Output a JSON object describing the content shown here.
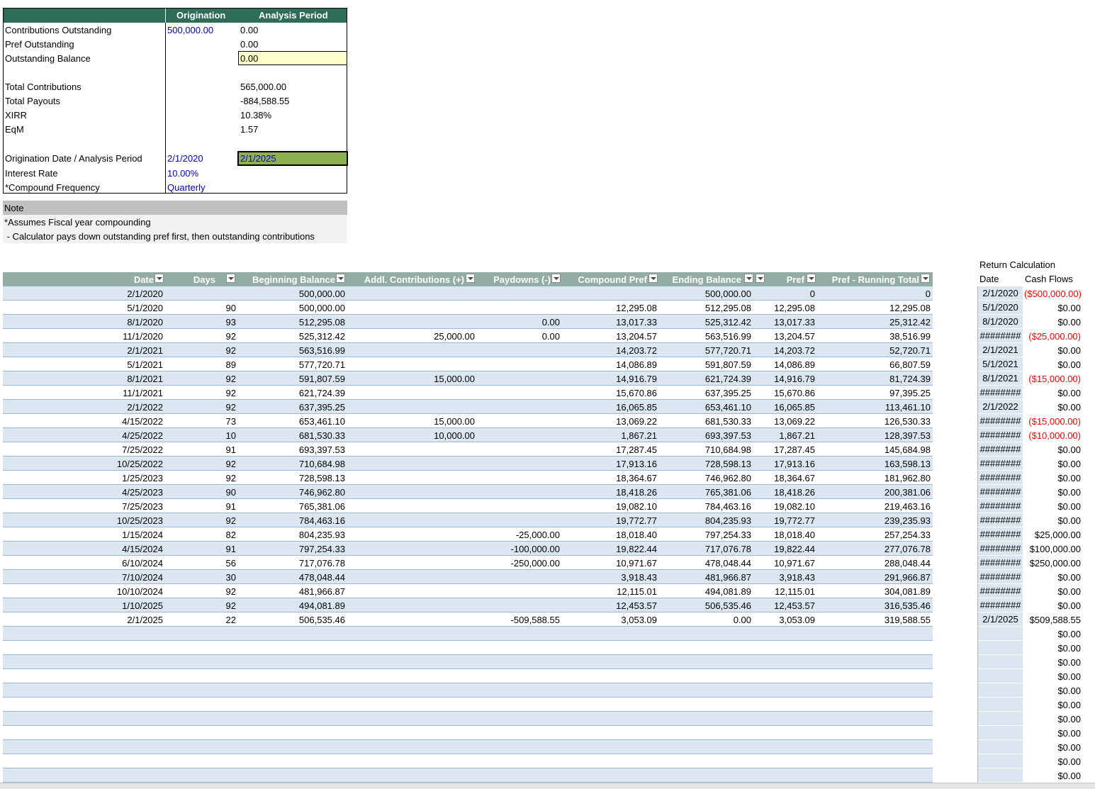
{
  "summary": {
    "col_origination": "Origination",
    "col_analysis": "Analysis Period",
    "rows": [
      {
        "label": "Contributions Outstanding",
        "origination": "500,000.00",
        "analysis": "0.00"
      },
      {
        "label": "Pref Outstanding",
        "origination": "",
        "analysis": "0.00"
      },
      {
        "label": "Outstanding Balance",
        "origination": "",
        "analysis": "0.00"
      },
      {
        "label": "Total Contributions",
        "origination": "",
        "analysis": "565,000.00"
      },
      {
        "label": "Total Payouts",
        "origination": "",
        "analysis": "-884,588.55"
      },
      {
        "label": "XIRR",
        "origination": "",
        "analysis": "10.38%"
      },
      {
        "label": "EqM",
        "origination": "",
        "analysis": "1.57"
      },
      {
        "label": "Origination Date / Analysis Period",
        "origination": "2/1/2020",
        "analysis": "2/1/2025"
      },
      {
        "label": "Interest Rate",
        "origination": "10.00%",
        "analysis": ""
      },
      {
        "label": "*Compound Frequency",
        "origination": "Quarterly",
        "analysis": ""
      }
    ]
  },
  "note": {
    "title": "Note",
    "lines": [
      "*Assumes Fiscal year compounding",
      " - Calculator pays down outstanding pref first, then outstanding contributions"
    ]
  },
  "table": {
    "columns": [
      "Date",
      "Days",
      "Beginning Balance",
      "Addl. Contributions (+)",
      "Paydowns (-)",
      "Compound Pref",
      "Ending Balance",
      "Pref",
      "Pref - Running Total"
    ],
    "rows": [
      [
        "2/1/2020",
        "",
        "500,000.00",
        "",
        "",
        "",
        "500,000.00",
        "0",
        "0"
      ],
      [
        "5/1/2020",
        "90",
        "500,000.00",
        "",
        "",
        "12,295.08",
        "512,295.08",
        "12,295.08",
        "12,295.08"
      ],
      [
        "8/1/2020",
        "93",
        "512,295.08",
        "",
        "0.00",
        "13,017.33",
        "525,312.42",
        "13,017.33",
        "25,312.42"
      ],
      [
        "11/1/2020",
        "92",
        "525,312.42",
        "25,000.00",
        "0.00",
        "13,204.57",
        "563,516.99",
        "13,204.57",
        "38,516.99"
      ],
      [
        "2/1/2021",
        "92",
        "563,516.99",
        "",
        "",
        "14,203.72",
        "577,720.71",
        "14,203.72",
        "52,720.71"
      ],
      [
        "5/1/2021",
        "89",
        "577,720.71",
        "",
        "",
        "14,086.89",
        "591,807.59",
        "14,086.89",
        "66,807.59"
      ],
      [
        "8/1/2021",
        "92",
        "591,807.59",
        "15,000.00",
        "",
        "14,916.79",
        "621,724.39",
        "14,916.79",
        "81,724.39"
      ],
      [
        "11/1/2021",
        "92",
        "621,724.39",
        "",
        "",
        "15,670.86",
        "637,395.25",
        "15,670.86",
        "97,395.25"
      ],
      [
        "2/1/2022",
        "92",
        "637,395.25",
        "",
        "",
        "16,065.85",
        "653,461.10",
        "16,065.85",
        "113,461.10"
      ],
      [
        "4/15/2022",
        "73",
        "653,461.10",
        "15,000.00",
        "",
        "13,069.22",
        "681,530.33",
        "13,069.22",
        "126,530.33"
      ],
      [
        "4/25/2022",
        "10",
        "681,530.33",
        "10,000.00",
        "",
        "1,867.21",
        "693,397.53",
        "1,867.21",
        "128,397.53"
      ],
      [
        "7/25/2022",
        "91",
        "693,397.53",
        "",
        "",
        "17,287.45",
        "710,684.98",
        "17,287.45",
        "145,684.98"
      ],
      [
        "10/25/2022",
        "92",
        "710,684.98",
        "",
        "",
        "17,913.16",
        "728,598.13",
        "17,913.16",
        "163,598.13"
      ],
      [
        "1/25/2023",
        "92",
        "728,598.13",
        "",
        "",
        "18,364.67",
        "746,962.80",
        "18,364.67",
        "181,962.80"
      ],
      [
        "4/25/2023",
        "90",
        "746,962.80",
        "",
        "",
        "18,418.26",
        "765,381.06",
        "18,418.26",
        "200,381.06"
      ],
      [
        "7/25/2023",
        "91",
        "765,381.06",
        "",
        "",
        "19,082.10",
        "784,463.16",
        "19,082.10",
        "219,463.16"
      ],
      [
        "10/25/2023",
        "92",
        "784,463.16",
        "",
        "",
        "19,772.77",
        "804,235.93",
        "19,772.77",
        "239,235.93"
      ],
      [
        "1/15/2024",
        "82",
        "804,235.93",
        "",
        "-25,000.00",
        "18,018.40",
        "797,254.33",
        "18,018.40",
        "257,254.33"
      ],
      [
        "4/15/2024",
        "91",
        "797,254.33",
        "",
        "-100,000.00",
        "19,822.44",
        "717,076.78",
        "19,822.44",
        "277,076.78"
      ],
      [
        "6/10/2024",
        "56",
        "717,076.78",
        "",
        "-250,000.00",
        "10,971.67",
        "478,048.44",
        "10,971.67",
        "288,048.44"
      ],
      [
        "7/10/2024",
        "30",
        "478,048.44",
        "",
        "",
        "3,918.43",
        "481,966.87",
        "3,918.43",
        "291,966.87"
      ],
      [
        "10/10/2024",
        "92",
        "481,966.87",
        "",
        "",
        "12,115.01",
        "494,081.89",
        "12,115.01",
        "304,081.89"
      ],
      [
        "1/10/2025",
        "92",
        "494,081.89",
        "",
        "",
        "12,453.57",
        "506,535.46",
        "12,453.57",
        "316,535.46"
      ],
      [
        "2/1/2025",
        "22",
        "506,535.46",
        "",
        "-509,588.55",
        "3,053.09",
        "0.00",
        "3,053.09",
        "319,588.55"
      ]
    ]
  },
  "return_calc": {
    "title": "Return Calculation",
    "date_header": "Date",
    "cf_header": "Cash Flows",
    "rows": [
      {
        "date": "2/1/2020",
        "cf": "($500,000.00)",
        "neg": true
      },
      {
        "date": "5/1/2020",
        "cf": "$0.00",
        "neg": false
      },
      {
        "date": "8/1/2020",
        "cf": "$0.00",
        "neg": false
      },
      {
        "date": "########",
        "cf": "($25,000.00)",
        "neg": true
      },
      {
        "date": "2/1/2021",
        "cf": "$0.00",
        "neg": false
      },
      {
        "date": "5/1/2021",
        "cf": "$0.00",
        "neg": false
      },
      {
        "date": "8/1/2021",
        "cf": "($15,000.00)",
        "neg": true
      },
      {
        "date": "########",
        "cf": "$0.00",
        "neg": false
      },
      {
        "date": "2/1/2022",
        "cf": "$0.00",
        "neg": false
      },
      {
        "date": "########",
        "cf": "($15,000.00)",
        "neg": true
      },
      {
        "date": "########",
        "cf": "($10,000.00)",
        "neg": true
      },
      {
        "date": "########",
        "cf": "$0.00",
        "neg": false
      },
      {
        "date": "########",
        "cf": "$0.00",
        "neg": false
      },
      {
        "date": "########",
        "cf": "$0.00",
        "neg": false
      },
      {
        "date": "########",
        "cf": "$0.00",
        "neg": false
      },
      {
        "date": "########",
        "cf": "$0.00",
        "neg": false
      },
      {
        "date": "########",
        "cf": "$0.00",
        "neg": false
      },
      {
        "date": "########",
        "cf": "$25,000.00",
        "neg": false
      },
      {
        "date": "########",
        "cf": "$100,000.00",
        "neg": false
      },
      {
        "date": "########",
        "cf": "$250,000.00",
        "neg": false
      },
      {
        "date": "########",
        "cf": "$0.00",
        "neg": false
      },
      {
        "date": "########",
        "cf": "$0.00",
        "neg": false
      },
      {
        "date": "########",
        "cf": "$0.00",
        "neg": false
      },
      {
        "date": "2/1/2025",
        "cf": "$509,588.55",
        "neg": false
      },
      {
        "date": "",
        "cf": "$0.00",
        "neg": false
      },
      {
        "date": "",
        "cf": "$0.00",
        "neg": false
      },
      {
        "date": "",
        "cf": "$0.00",
        "neg": false
      },
      {
        "date": "",
        "cf": "$0.00",
        "neg": false
      },
      {
        "date": "",
        "cf": "$0.00",
        "neg": false
      },
      {
        "date": "",
        "cf": "$0.00",
        "neg": false
      },
      {
        "date": "",
        "cf": "$0.00",
        "neg": false
      },
      {
        "date": "",
        "cf": "$0.00",
        "neg": false
      },
      {
        "date": "",
        "cf": "$0.00",
        "neg": false
      },
      {
        "date": "",
        "cf": "$0.00",
        "neg": false
      },
      {
        "date": "",
        "cf": "$0.00",
        "neg": false
      }
    ]
  },
  "colors": {
    "header_green": "#2e6b58",
    "table_header": "#93ada6",
    "band": "#dce6f1",
    "input_blue": "#0000cc",
    "negative_red": "#ff0000",
    "highlight_yellow": "#ffffcc",
    "highlight_green": "#8fb050"
  }
}
